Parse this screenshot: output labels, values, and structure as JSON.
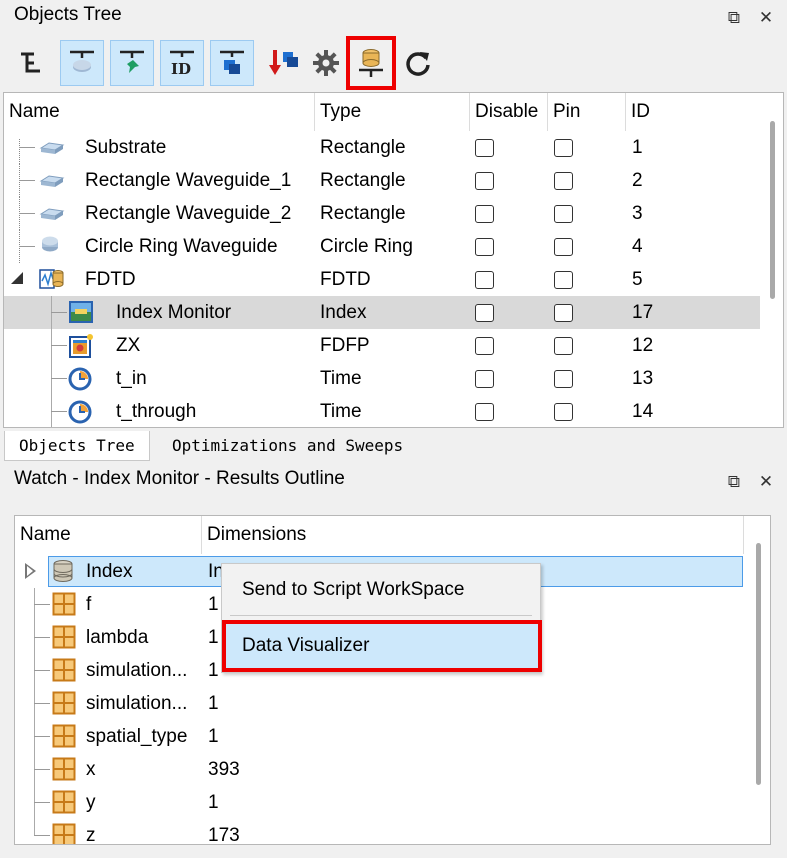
{
  "objects_panel": {
    "title": "Objects Tree",
    "restore_glyph": "⧉",
    "close_glyph": "✕"
  },
  "toolbar": {
    "buttons": [
      {
        "name": "tree-view-icon",
        "selected": false
      },
      {
        "name": "show-geometry-icon",
        "selected": true
      },
      {
        "name": "show-pin-icon",
        "selected": true
      },
      {
        "name": "show-id-icon",
        "selected": true
      },
      {
        "name": "show-type-icon",
        "selected": true
      },
      {
        "name": "sort-icon",
        "selected": false
      },
      {
        "name": "gear-icon",
        "selected": false
      },
      {
        "name": "results-outline-icon",
        "selected": false,
        "highlighted": true
      },
      {
        "name": "refresh-icon",
        "selected": false
      }
    ],
    "id_label": "ID"
  },
  "objects_table": {
    "columns": [
      "Name",
      "Type",
      "Disable",
      "Pin",
      "ID"
    ],
    "rows": [
      {
        "name": "Substrate",
        "type": "Rectangle",
        "id": "1",
        "icon": "rectangle-icon",
        "level": 0
      },
      {
        "name": "Rectangle Waveguide_1",
        "type": "Rectangle",
        "id": "2",
        "icon": "rectangle-icon",
        "level": 0
      },
      {
        "name": "Rectangle Waveguide_2",
        "type": "Rectangle",
        "id": "3",
        "icon": "rectangle-icon",
        "level": 0
      },
      {
        "name": "Circle Ring Waveguide",
        "type": "Circle Ring",
        "id": "4",
        "icon": "circle-ring-icon",
        "level": 0
      },
      {
        "name": "FDTD",
        "type": "FDTD",
        "id": "5",
        "icon": "fdtd-icon",
        "level": 0
      },
      {
        "name": "Index Monitor",
        "type": "Index",
        "id": "17",
        "icon": "index-monitor-icon",
        "level": 1
      },
      {
        "name": "ZX",
        "type": "FDFP",
        "id": "12",
        "icon": "fdfp-monitor-icon",
        "level": 1
      },
      {
        "name": "t_in",
        "type": "Time",
        "id": "13",
        "icon": "time-monitor-icon",
        "level": 1
      },
      {
        "name": "t_through",
        "type": "Time",
        "id": "14",
        "icon": "time-monitor-icon",
        "level": 1
      }
    ]
  },
  "tabs": [
    {
      "label": "Objects Tree",
      "active": true
    },
    {
      "label": "Optimizations and Sweeps",
      "active": false
    }
  ],
  "watch_panel": {
    "title": "Watch - Index Monitor - Results Outline",
    "restore_glyph": "⧉",
    "close_glyph": "✕"
  },
  "results_table": {
    "columns": [
      "Name",
      "Dimensions"
    ],
    "rows": [
      {
        "name": "Index",
        "dims": "In",
        "icon": "dataset-icon"
      },
      {
        "name": "f",
        "dims": "1",
        "icon": "matrix-icon"
      },
      {
        "name": "lambda",
        "dims": "1",
        "icon": "matrix-icon"
      },
      {
        "name": "simulation...",
        "dims": "1",
        "icon": "matrix-icon"
      },
      {
        "name": "simulation...",
        "dims": "1",
        "icon": "matrix-icon"
      },
      {
        "name": "spatial_type",
        "dims": "1",
        "icon": "matrix-icon"
      },
      {
        "name": "x",
        "dims": "393",
        "icon": "matrix-icon"
      },
      {
        "name": "y",
        "dims": "1",
        "icon": "matrix-icon"
      },
      {
        "name": "z",
        "dims": "173",
        "icon": "matrix-icon"
      }
    ]
  },
  "context_menu": {
    "items": [
      {
        "label": "Send to Script WorkSpace"
      },
      {
        "label": "Data Visualizer",
        "highlighted": true
      }
    ]
  },
  "colors": {
    "selection": "#cde8fb",
    "highlight_box": "#ee0000",
    "selected_row": "#d9d9d9"
  }
}
